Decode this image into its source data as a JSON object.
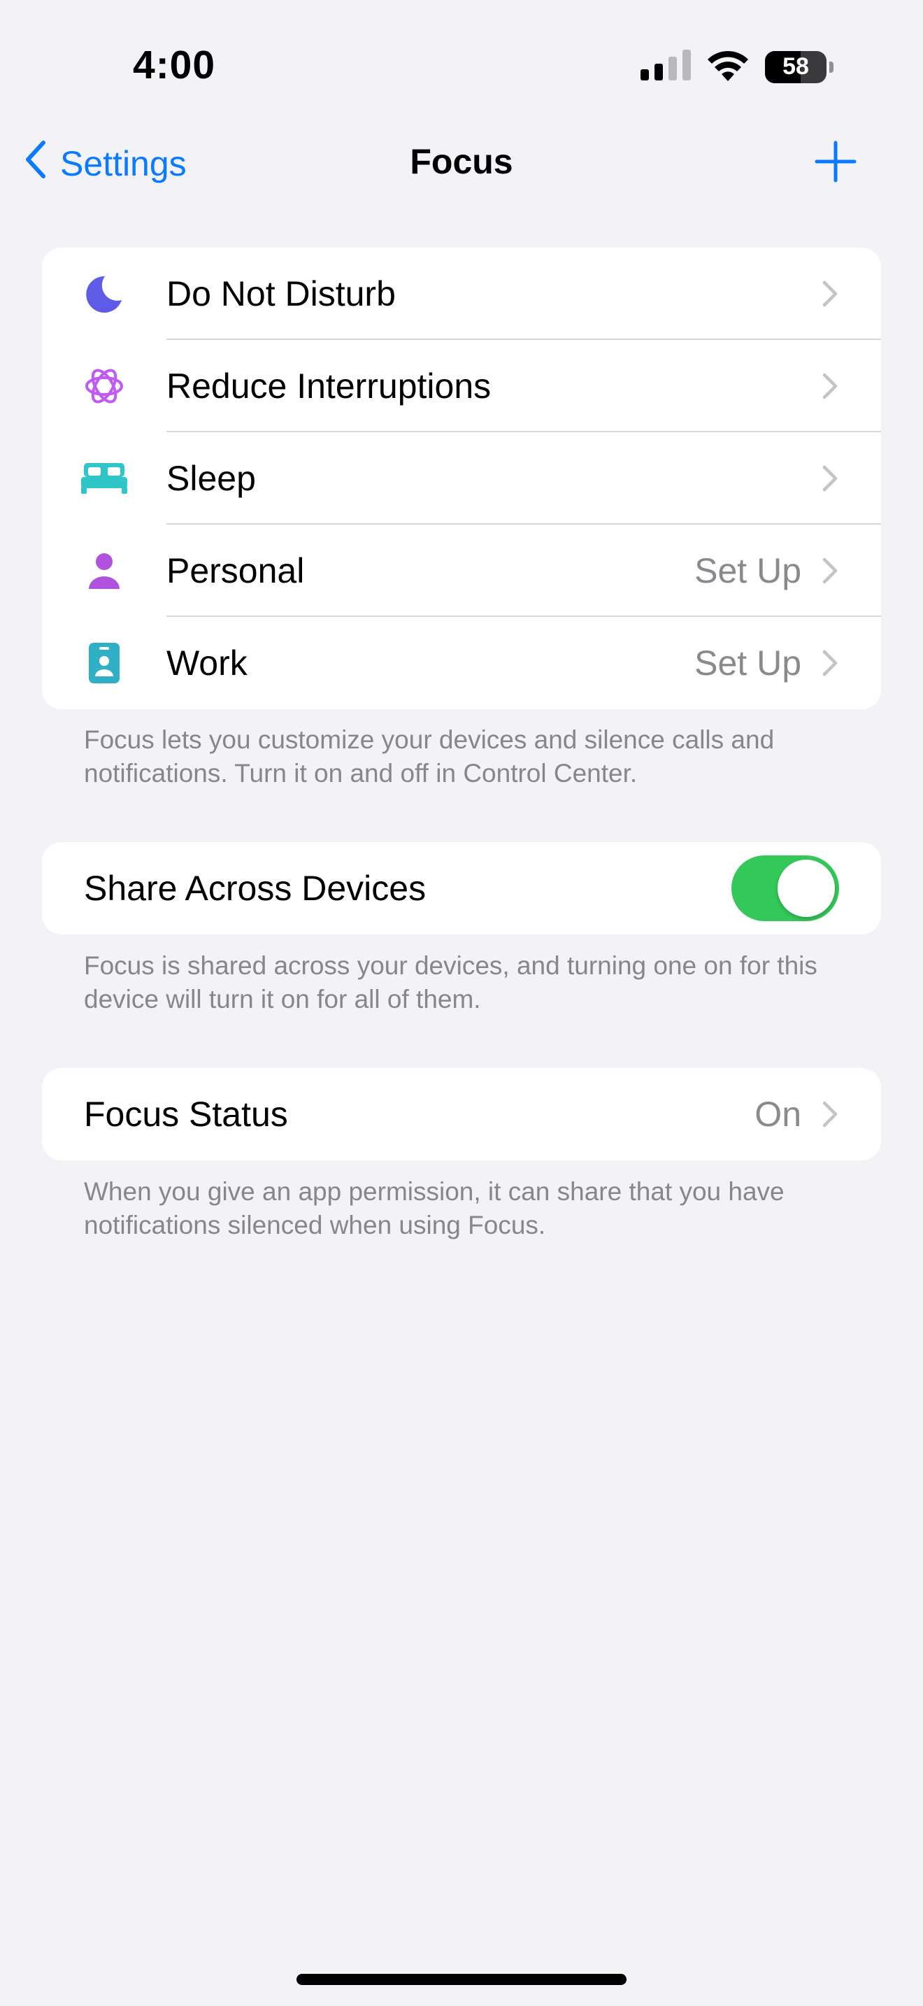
{
  "status_bar": {
    "time": "4:00",
    "battery_percent": "58",
    "battery_level": 0.58,
    "icons": [
      "cellular-signal-icon",
      "wifi-icon",
      "battery-icon"
    ]
  },
  "nav": {
    "back_label": "Settings",
    "title": "Focus",
    "add_icon": "plus-icon"
  },
  "modes": [
    {
      "label": "Do Not Disturb",
      "icon": "moon-icon",
      "color": "#5e5ce6",
      "value": ""
    },
    {
      "label": "Reduce Interruptions",
      "icon": "reduce-interruptions-icon",
      "color": "#bf5af2",
      "value": ""
    },
    {
      "label": "Sleep",
      "icon": "bed-icon",
      "color": "#30c6c8",
      "value": ""
    },
    {
      "label": "Personal",
      "icon": "person-icon",
      "color": "#af52de",
      "value": "Set Up"
    },
    {
      "label": "Work",
      "icon": "id-badge-icon",
      "color": "#30b0c7",
      "value": "Set Up"
    }
  ],
  "modes_footnote": "Focus lets you customize your devices and silence calls and notifications. Turn it on and off in Control Center.",
  "share": {
    "label": "Share Across Devices",
    "enabled": true,
    "toggle_color": "#34c759",
    "footnote": "Focus is shared across your devices, and turning one on for this device will turn it on for all of them."
  },
  "focus_status": {
    "label": "Focus Status",
    "value": "On",
    "footnote": "When you give an app permission, it can share that you have notifications silenced when using Focus."
  },
  "colors": {
    "accent": "#0a7aff",
    "background": "#f2f2f7",
    "secondary_text": "#8a8a8e"
  }
}
